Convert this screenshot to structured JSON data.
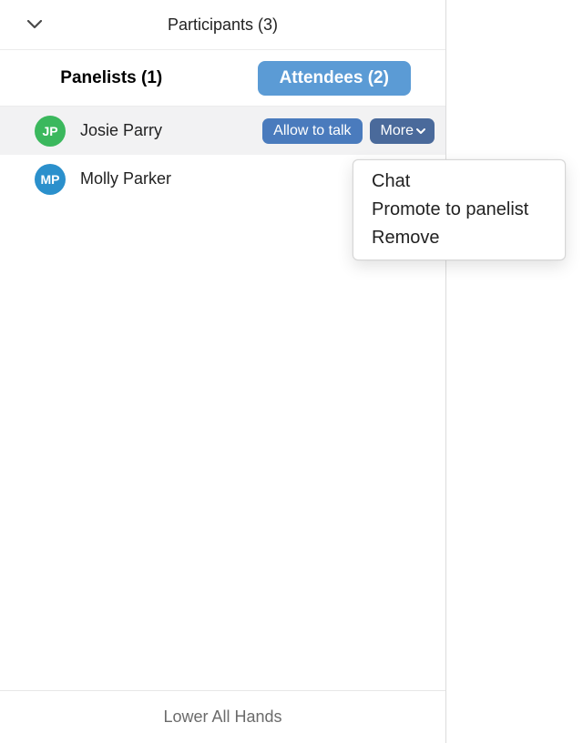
{
  "header": {
    "title": "Participants (3)"
  },
  "tabs": {
    "panelists": "Panelists (1)",
    "attendees": "Attendees (2)"
  },
  "attendees": [
    {
      "initials": "JP",
      "name": "Josie Parry",
      "avatarColor": "green",
      "selected": true
    },
    {
      "initials": "MP",
      "name": "Molly Parker",
      "avatarColor": "blue",
      "selected": false
    }
  ],
  "buttons": {
    "allow_to_talk": "Allow to talk",
    "more": "More"
  },
  "dropdown": {
    "chat": "Chat",
    "promote": "Promote to panelist",
    "remove": "Remove"
  },
  "footer": {
    "lower_all_hands": "Lower All Hands"
  }
}
